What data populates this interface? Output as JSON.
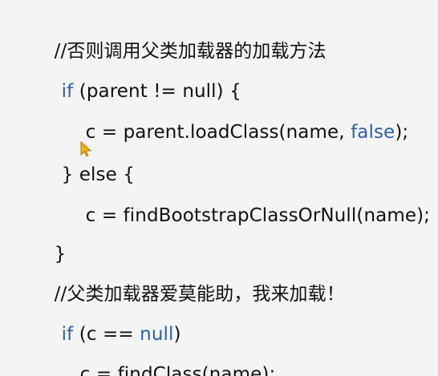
{
  "code": {
    "comment_parent": "//否则调用父类加载器的加载方法",
    "if_keyword": "if",
    "if_condition_text": " (parent != null) {",
    "assign_parent_prefix": "c = parent.loadClass(name, ",
    "false_keyword": "false",
    "assign_parent_suffix": ");",
    "else_text": "} else {",
    "assign_bootstrap": "c = findBootstrapClassOrNull(name);",
    "close_brace": "}",
    "comment_help": "//父类加载器爱莫能助，我来加载！",
    "if_keyword_2": "if",
    "if_null_prefix": " (c == ",
    "null_keyword": "null",
    "if_null_suffix": ")",
    "assign_find": "c = findClass(name);"
  },
  "icons": {
    "cursor": "mouse-pointer-icon"
  },
  "colors": {
    "background": "#f4f4f4",
    "text": "#111111",
    "keyword": "#2f5fa8",
    "cursor_fill": "#f0b400",
    "cursor_outline": "#b97800"
  }
}
